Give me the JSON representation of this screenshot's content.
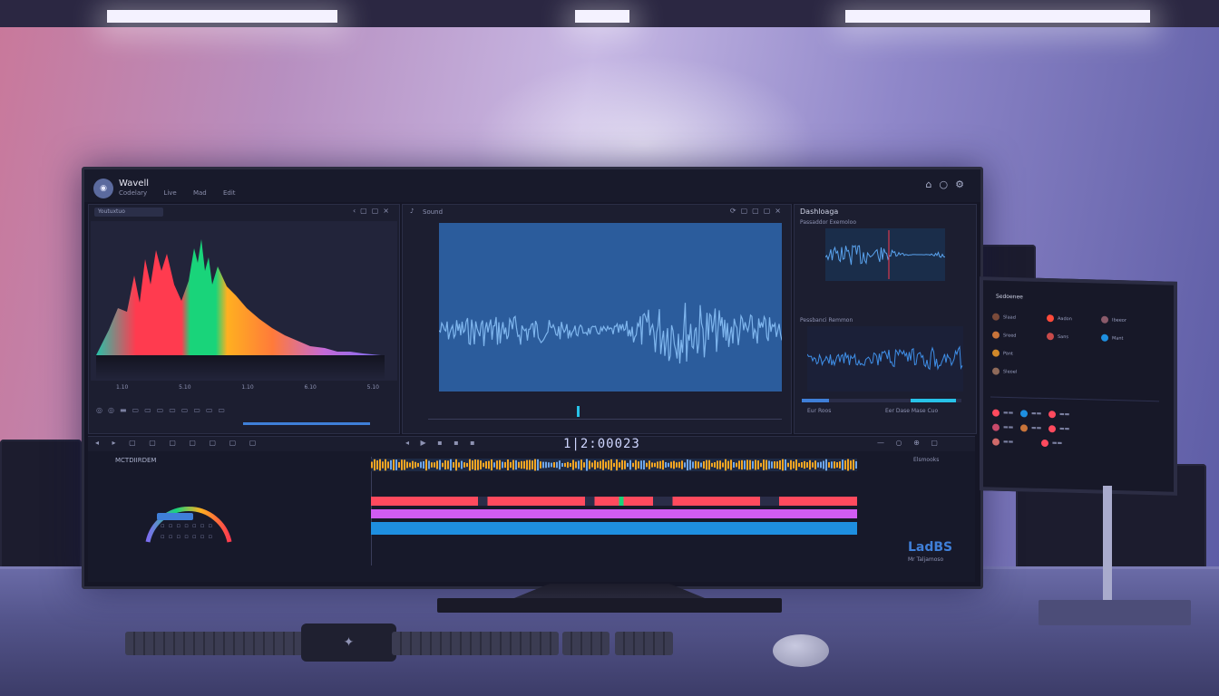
{
  "app": {
    "title": "Wavell",
    "menu": [
      "Codelary",
      "Live",
      "Mad",
      "Edit"
    ]
  },
  "left_panel": {
    "dropdown": "Youtuxtuo",
    "ticks": [
      "1.10",
      "5.10",
      "1.10",
      "6.10",
      "5.10"
    ]
  },
  "center_panel": {
    "title": "Sound"
  },
  "right_panel": {
    "title": "Dashloaga",
    "sub_a": "Passaddor Exemoloo",
    "sub_b": "Pessbanci Remmon",
    "foot_a": "Eur Roos",
    "foot_b": "Eer Dase Mase Cuo"
  },
  "timeline": {
    "timecode": "1|2:00023",
    "label": "MCTDIIRDEM",
    "right_label": "Elsmooks"
  },
  "watermark": {
    "main": "LadBS",
    "sub": "Mr Taljamoso"
  },
  "side_monitor": {
    "title": "Sedoenee",
    "rows": [
      "Slaad",
      "Sreed",
      "Pant",
      "Sleoel",
      "Aadon",
      "Sans",
      "Ibeeor",
      "Mant"
    ]
  },
  "colors": {
    "accent": "#3f7fd8",
    "spectrum": [
      "#27c2a8",
      "#ff3b4f",
      "#19d47a",
      "#ffb020",
      "#ff7a3a",
      "#7c6cf0"
    ],
    "track_orange": "#f5a623",
    "track_red": "#ff4a5e",
    "track_magenta": "#d05cf2",
    "track_blue": "#1e8fe0"
  }
}
